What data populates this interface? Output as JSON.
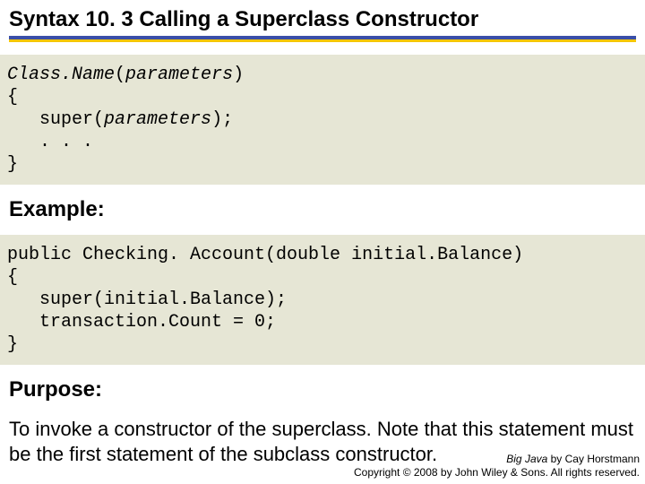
{
  "title": "Syntax 10. 3 Calling a Superclass Constructor",
  "syntax": {
    "l1a": "Class.Name",
    "l1b": "(",
    "l1c": "parameters",
    "l1d": ")",
    "l2": "{",
    "l3a": "   super(",
    "l3b": "parameters",
    "l3c": ");",
    "l4": "   . . .",
    "l5": "}"
  },
  "example_label": "Example:",
  "example": {
    "l1": "public Checking. Account(double initial.Balance)",
    "l2": "{",
    "l3": "   super(initial.Balance);",
    "l4": "   transaction.Count = 0;",
    "l5": "}"
  },
  "purpose_label": "Purpose:",
  "purpose_text": "To invoke a constructor of the superclass. Note that this statement must be the first statement of the subclass constructor.",
  "footer": {
    "book": "Big Java",
    "by": " by Cay Horstmann",
    "copy": "Copyright © 2008 by John Wiley & Sons. All rights reserved."
  }
}
